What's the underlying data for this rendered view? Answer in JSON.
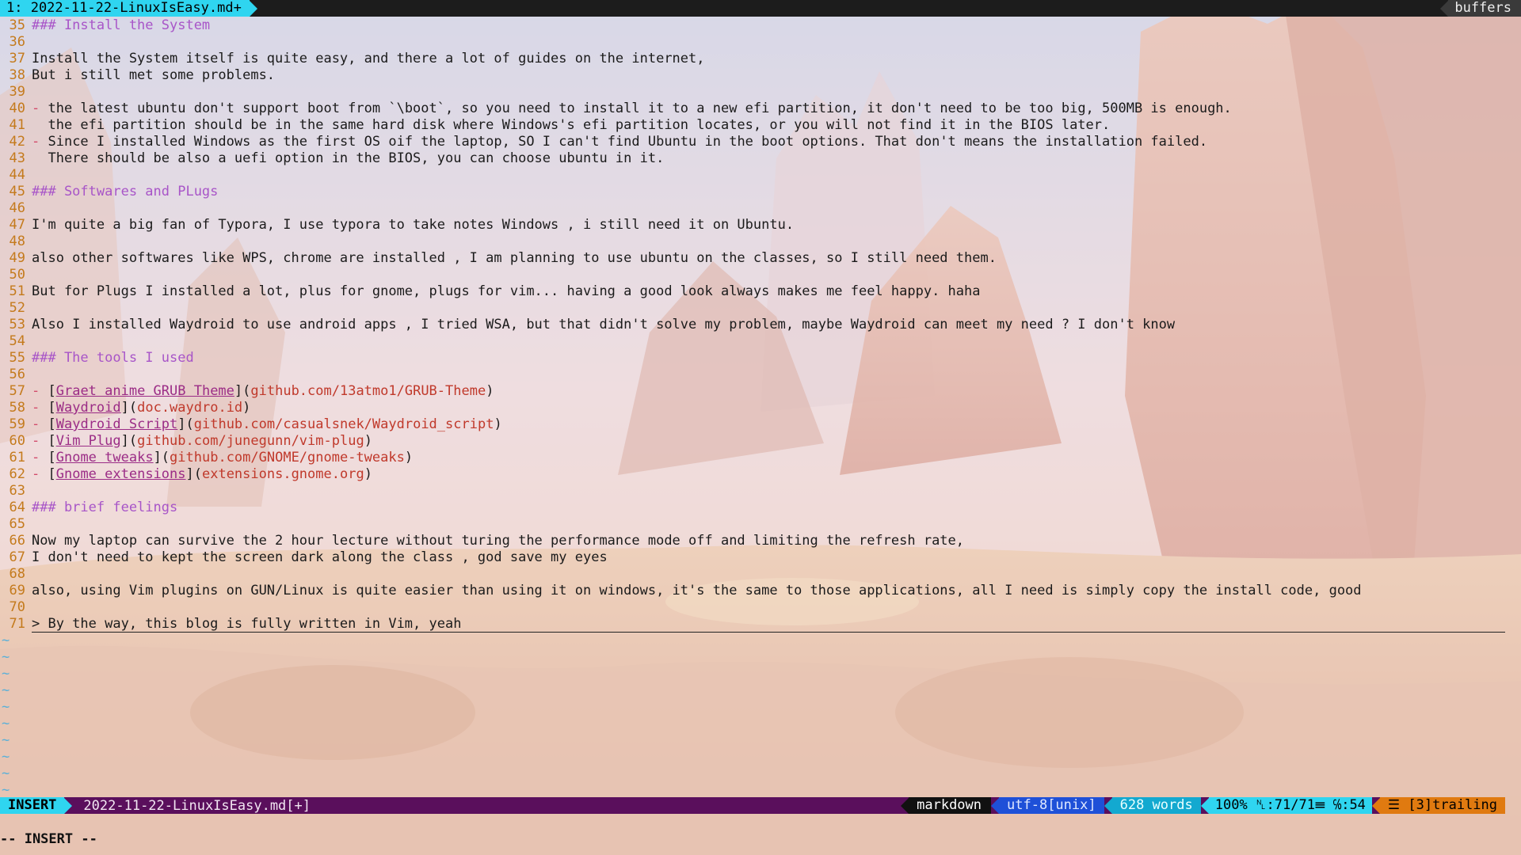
{
  "tabline": {
    "active_tab": "1: 2022-11-22-LinuxIsEasy.md+",
    "buffers_label": "buffers"
  },
  "lines": [
    {
      "n": "35",
      "kind": "heading",
      "text": "### Install the System"
    },
    {
      "n": "36",
      "kind": "text",
      "text": ""
    },
    {
      "n": "37",
      "kind": "text",
      "text": "Install the System itself is quite easy, and there a lot of guides on the internet,"
    },
    {
      "n": "38",
      "kind": "text",
      "text": "But i still met some problems."
    },
    {
      "n": "39",
      "kind": "text",
      "text": ""
    },
    {
      "n": "40",
      "kind": "bullet",
      "text": " the latest ubuntu don't support boot from `\\boot`, so you need to install it to a new efi partition, it don't need to be too big, 500MB is enough."
    },
    {
      "n": "41",
      "kind": "text",
      "text": "  the efi partition should be in the same hard disk where Windows's efi partition locates, or you will not find it in the BIOS later."
    },
    {
      "n": "42",
      "kind": "bullet",
      "text": " Since I installed Windows as the first OS oif the laptop, SO I can't find Ubuntu in the boot options. That don't means the installation failed."
    },
    {
      "n": "43",
      "kind": "text",
      "text": "  There should be also a uefi option in the BIOS, you can choose ubuntu in it."
    },
    {
      "n": "44",
      "kind": "text",
      "text": ""
    },
    {
      "n": "45",
      "kind": "heading",
      "text": "### Softwares and PLugs"
    },
    {
      "n": "46",
      "kind": "text",
      "text": ""
    },
    {
      "n": "47",
      "kind": "text",
      "text": "I'm quite a big fan of Typora, I use typora to take notes Windows , i still need it on Ubuntu."
    },
    {
      "n": "48",
      "kind": "text",
      "text": ""
    },
    {
      "n": "49",
      "kind": "text",
      "text": "also other softwares like WPS, chrome are installed , I am planning to use ubuntu on the classes, so I still need them."
    },
    {
      "n": "50",
      "kind": "text",
      "text": ""
    },
    {
      "n": "51",
      "kind": "text",
      "text": "But for Plugs I installed a lot, plus for gnome, plugs for vim... having a good look always makes me feel happy. haha"
    },
    {
      "n": "52",
      "kind": "text",
      "text": ""
    },
    {
      "n": "53",
      "kind": "text",
      "text": "Also I installed Waydroid to use android apps , I tried WSA, but that didn't solve my problem, maybe Waydroid can meet my need ? I don't know"
    },
    {
      "n": "54",
      "kind": "text",
      "text": ""
    },
    {
      "n": "55",
      "kind": "heading",
      "text": "### The tools I used"
    },
    {
      "n": "56",
      "kind": "text",
      "text": ""
    },
    {
      "n": "57",
      "kind": "link",
      "label": "Graet anime GRUB Theme",
      "url": "github.com/13atmo1/GRUB-Theme"
    },
    {
      "n": "58",
      "kind": "link",
      "label": "Waydroid",
      "url": "doc.waydro.id"
    },
    {
      "n": "59",
      "kind": "link",
      "label": "Waydroid Script",
      "url": "github.com/casualsnek/Waydroid_script"
    },
    {
      "n": "60",
      "kind": "link",
      "label": "Vim Plug",
      "url": "github.com/junegunn/vim-plug"
    },
    {
      "n": "61",
      "kind": "link",
      "label": "Gnome tweaks",
      "url": "github.com/GNOME/gnome-tweaks"
    },
    {
      "n": "62",
      "kind": "link",
      "label": "Gnome extensions",
      "url": "extensions.gnome.org"
    },
    {
      "n": "63",
      "kind": "text",
      "text": ""
    },
    {
      "n": "64",
      "kind": "heading",
      "text": "### brief feelings"
    },
    {
      "n": "65",
      "kind": "text",
      "text": ""
    },
    {
      "n": "66",
      "kind": "text",
      "text": "Now my laptop can survive the 2 hour lecture without turing the performance mode off and limiting the refresh rate,"
    },
    {
      "n": "67",
      "kind": "text",
      "text": "I don't need to kept the screen dark along the class , god save my eyes"
    },
    {
      "n": "68",
      "kind": "text",
      "text": ""
    },
    {
      "n": "69",
      "kind": "text",
      "text": "also, using Vim plugins on GUN/Linux is quite easier than using it on windows, it's the same to those applications, all I need is simply copy the install code, good"
    },
    {
      "n": "70",
      "kind": "text",
      "text": ""
    },
    {
      "n": "71",
      "kind": "current",
      "text": "> By the way, this blog is fully written in Vim, yeah"
    }
  ],
  "tilde_lines": [
    "~",
    "~",
    "~",
    "~",
    "~",
    "~",
    "~",
    "~",
    "~",
    "~"
  ],
  "statusline": {
    "mode": "INSERT",
    "filename": "2022-11-22-LinuxIsEasy.md[+]",
    "filetype": "markdown",
    "encoding": "utf-8[unix]",
    "word_count": "628 words",
    "percent": "100%",
    "position": ":71/71",
    "column": ":54",
    "trailing": "[3]trailing"
  },
  "cmdline": "-- INSERT --",
  "colors": {
    "tab_active": "#2fd5f0",
    "statusline_bg": "#5a0f5c",
    "line_number": "#c47a1c",
    "heading": "#a855c8",
    "link_text": "#9b2c86",
    "link_url": "#c0392b",
    "trailing_bg": "#e07a10",
    "encoding_bg": "#1e50d8"
  }
}
